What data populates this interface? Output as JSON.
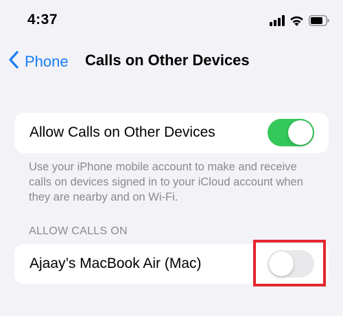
{
  "status_bar": {
    "time": "4:37"
  },
  "nav": {
    "back_label": "Phone",
    "title": "Calls on Other Devices"
  },
  "main_toggle": {
    "label": "Allow Calls on Other Devices",
    "state": "on"
  },
  "footer": {
    "text": "Use your iPhone mobile account to make and receive calls on devices signed in to your iCloud account when they are nearby and on Wi-Fi."
  },
  "section": {
    "header": "ALLOW CALLS ON"
  },
  "devices": [
    {
      "label": "Ajaay’s MacBook Air (Mac)",
      "state": "off"
    }
  ],
  "colors": {
    "accent": "#1a7cf5",
    "toggle_on": "#34c759",
    "toggle_off": "#e9e9eb",
    "highlight": "#e3262f",
    "background": "#f2f2f7"
  },
  "icons": [
    "signal-icon",
    "wifi-icon",
    "battery-icon",
    "chevron-left-icon"
  ]
}
